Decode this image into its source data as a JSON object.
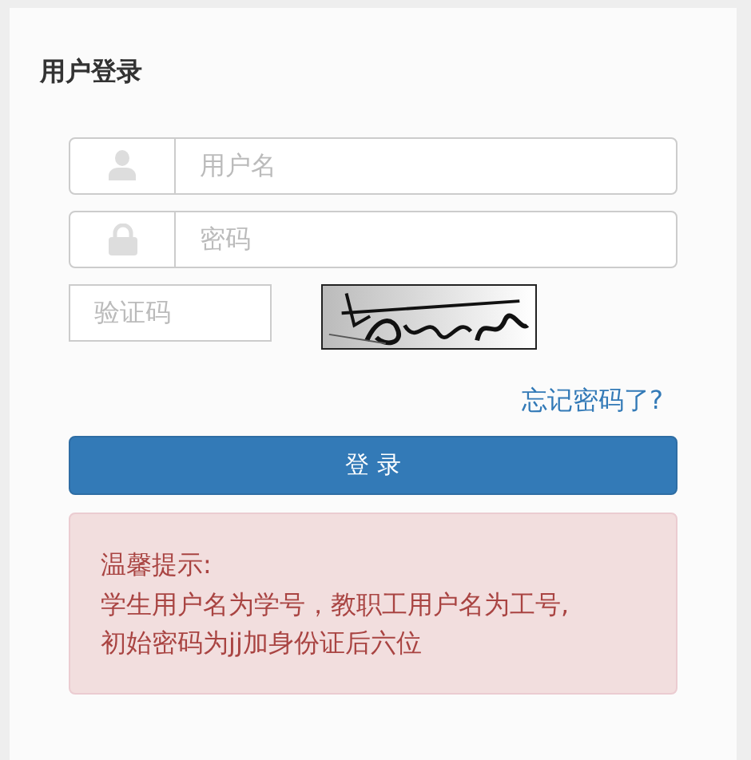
{
  "title": "用户登录",
  "fields": [
    {
      "kind": "username",
      "placeholder": "用户名"
    },
    {
      "kind": "password",
      "placeholder": "密码"
    }
  ],
  "captcha": {
    "placeholder": "验证码"
  },
  "forgot_link": "忘记密码了?",
  "login_button": "登 录",
  "notice": [
    "温馨提示:",
    "学生用户名为学号，教职工用户名为工号,",
    "初始密码为jj加身份证后六位"
  ]
}
